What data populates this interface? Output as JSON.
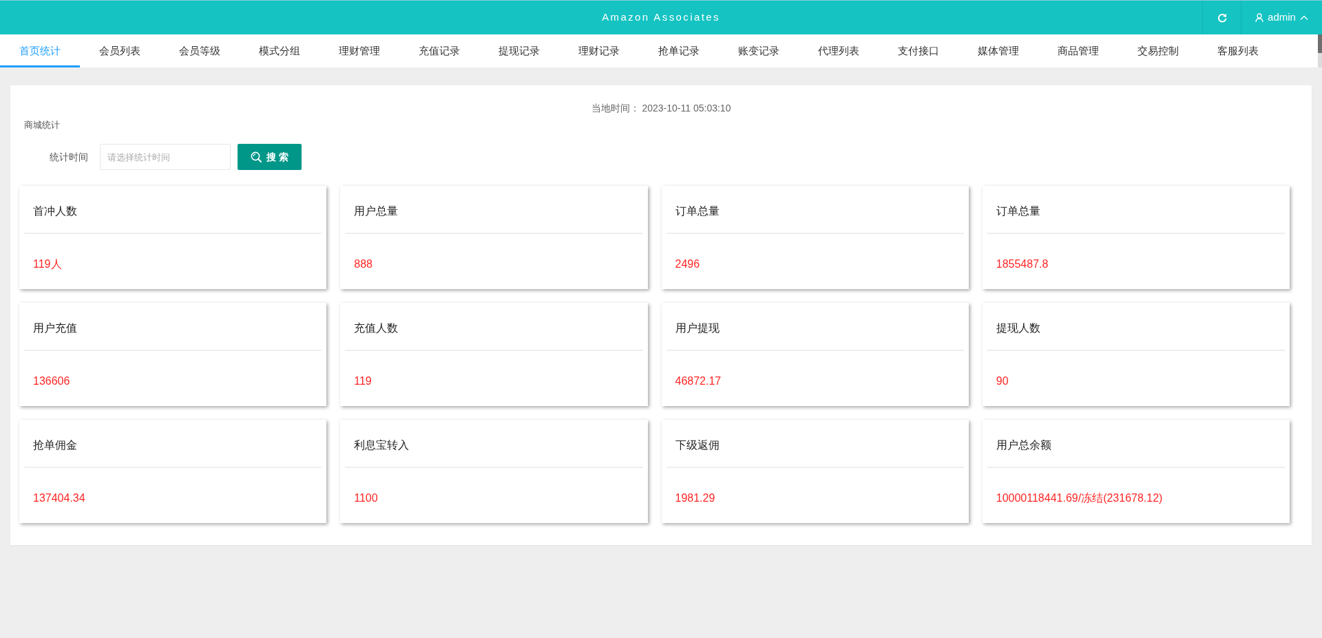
{
  "header": {
    "title": "Amazon Associates",
    "user": "admin"
  },
  "tabs": [
    {
      "label": "首页统计",
      "selected": true
    },
    {
      "label": "会员列表",
      "selected": false
    },
    {
      "label": "会员等级",
      "selected": false
    },
    {
      "label": "模式分组",
      "selected": false
    },
    {
      "label": "理财管理",
      "selected": false
    },
    {
      "label": "充值记录",
      "selected": false
    },
    {
      "label": "提现记录",
      "selected": false
    },
    {
      "label": "理财记录",
      "selected": false
    },
    {
      "label": "抢单记录",
      "selected": false
    },
    {
      "label": "账变记录",
      "selected": false
    },
    {
      "label": "代理列表",
      "selected": false
    },
    {
      "label": "支付接口",
      "selected": false
    },
    {
      "label": "媒体管理",
      "selected": false
    },
    {
      "label": "商品管理",
      "selected": false
    },
    {
      "label": "交易控制",
      "selected": false
    },
    {
      "label": "客服列表",
      "selected": false
    }
  ],
  "panel": {
    "local_time": "当地时间： 2023-10-11 05:03:10",
    "section_title": "商城统计",
    "filter": {
      "label": "统计时间",
      "placeholder": "请选择统计时间",
      "button": "搜 索"
    }
  },
  "stats": [
    {
      "title": "首冲人数",
      "value": "119人"
    },
    {
      "title": "用户总量",
      "value": "888"
    },
    {
      "title": "订单总量",
      "value": "2496"
    },
    {
      "title": "订单总量",
      "value": "1855487.8"
    },
    {
      "title": "用户充值",
      "value": "136606"
    },
    {
      "title": "充值人数",
      "value": "119"
    },
    {
      "title": "用户提现",
      "value": "46872.17"
    },
    {
      "title": "提现人数",
      "value": "90"
    },
    {
      "title": "抢单佣金",
      "value": "137404.34"
    },
    {
      "title": "利息宝转入",
      "value": "1100"
    },
    {
      "title": "下级返佣",
      "value": "1981.29"
    },
    {
      "title": "用户总余额",
      "value": "10000118441.69/冻结(231678.12)"
    }
  ]
}
